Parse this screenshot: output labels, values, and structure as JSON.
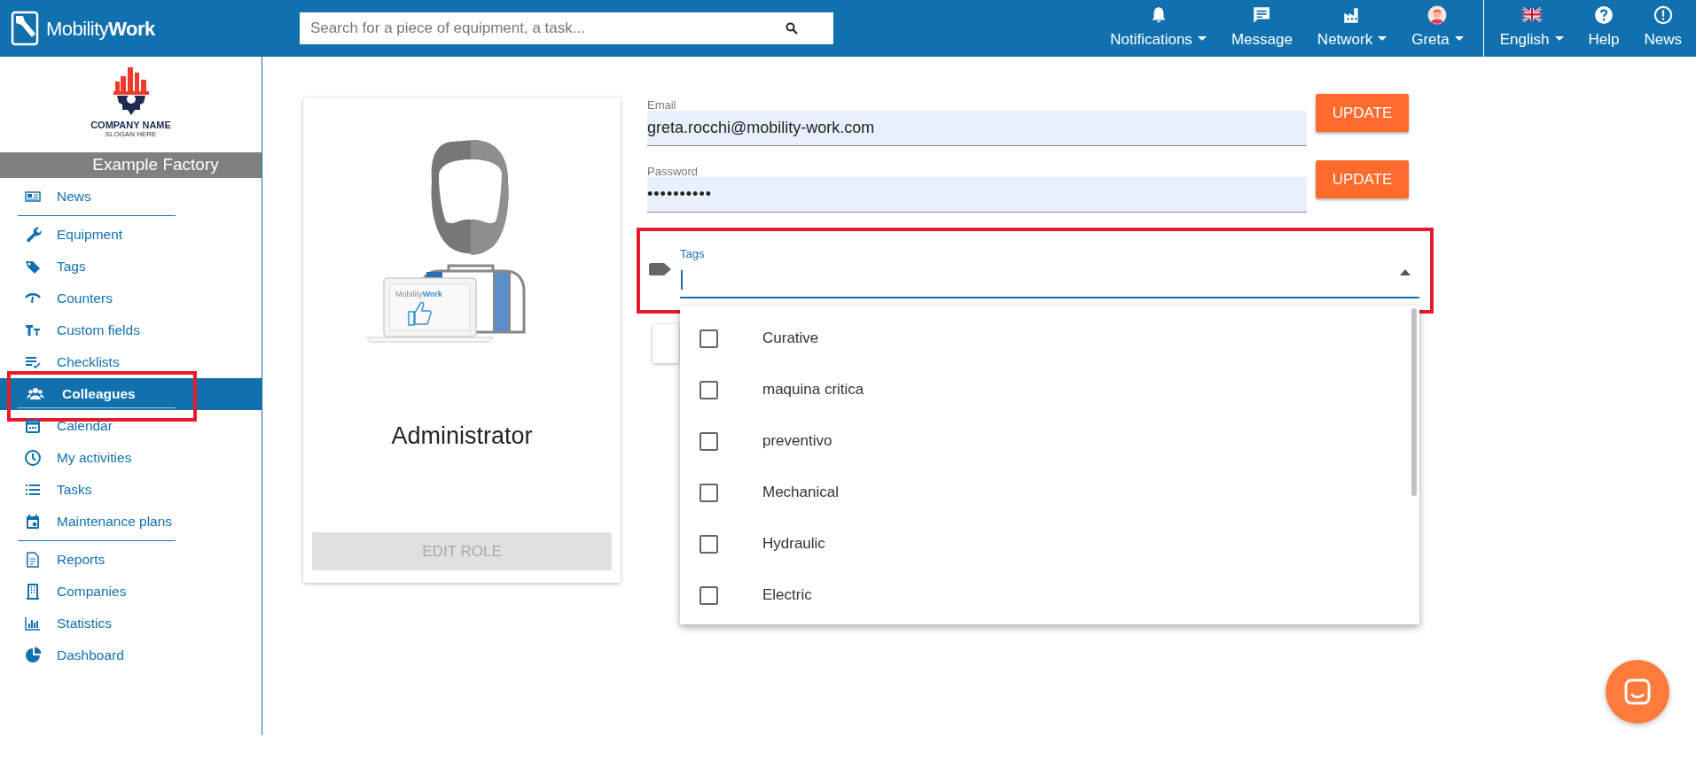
{
  "header": {
    "logo_text": "Mobility**Work**",
    "search": {
      "placeholder": "Search for a piece of equipment, a task..."
    },
    "nav": [
      {
        "label": "Notifications",
        "dropdown": true
      },
      {
        "label": "Message",
        "dropdown": false
      },
      {
        "label": "Network",
        "dropdown": true
      },
      {
        "label": "Greta",
        "dropdown": true
      }
    ],
    "nav_right": [
      {
        "label": "English",
        "dropdown": true
      },
      {
        "label": "Help",
        "dropdown": false
      },
      {
        "label": "News",
        "dropdown": false
      }
    ]
  },
  "sidebar": {
    "company_logo": {
      "name": "COMPANY NAME",
      "slogan": "SLOGAN HERE"
    },
    "site": "Example Factory",
    "sections": [
      [
        {
          "label": "News",
          "selected": false
        }
      ],
      [
        {
          "label": "Equipment",
          "selected": false
        },
        {
          "label": "Tags",
          "selected": false
        },
        {
          "label": "Counters",
          "selected": false
        },
        {
          "label": "Custom fields",
          "selected": false
        },
        {
          "label": "Checklists",
          "selected": false
        },
        {
          "label": "Colleagues",
          "selected": true,
          "highlighted": true
        },
        {
          "label": "Calendar",
          "selected": false
        },
        {
          "label": "My activities",
          "selected": false
        },
        {
          "label": "Tasks",
          "selected": false
        },
        {
          "label": "Maintenance plans",
          "selected": false
        }
      ],
      [
        {
          "label": "Reports",
          "selected": false
        },
        {
          "label": "Companies",
          "selected": false
        },
        {
          "label": "Statistics",
          "selected": false
        },
        {
          "label": "Dashboard",
          "selected": false
        }
      ]
    ]
  },
  "profile": {
    "laptop_text": "Mobility**Work**",
    "role": "Administrator",
    "edit_button": {
      "label": "EDIT ROLE",
      "disabled": true
    }
  },
  "form": {
    "fields": [
      {
        "kind": "text",
        "label": "Email",
        "value": "greta.rocchi@mobility-work.com",
        "button": "UPDATE"
      },
      {
        "kind": "password",
        "label": "Password",
        "value": "••••••••••",
        "button": "UPDATE"
      }
    ],
    "tags": {
      "label": "Tags",
      "expanded": true,
      "highlighted": true,
      "options": [
        {
          "label": "Curative",
          "checked": false
        },
        {
          "label": "maquina critica",
          "checked": false
        },
        {
          "label": "preventivo",
          "checked": false
        },
        {
          "label": "Mechanical",
          "checked": false
        },
        {
          "label": "Hydraulic",
          "checked": false
        },
        {
          "label": "Electric",
          "checked": false
        }
      ]
    }
  }
}
